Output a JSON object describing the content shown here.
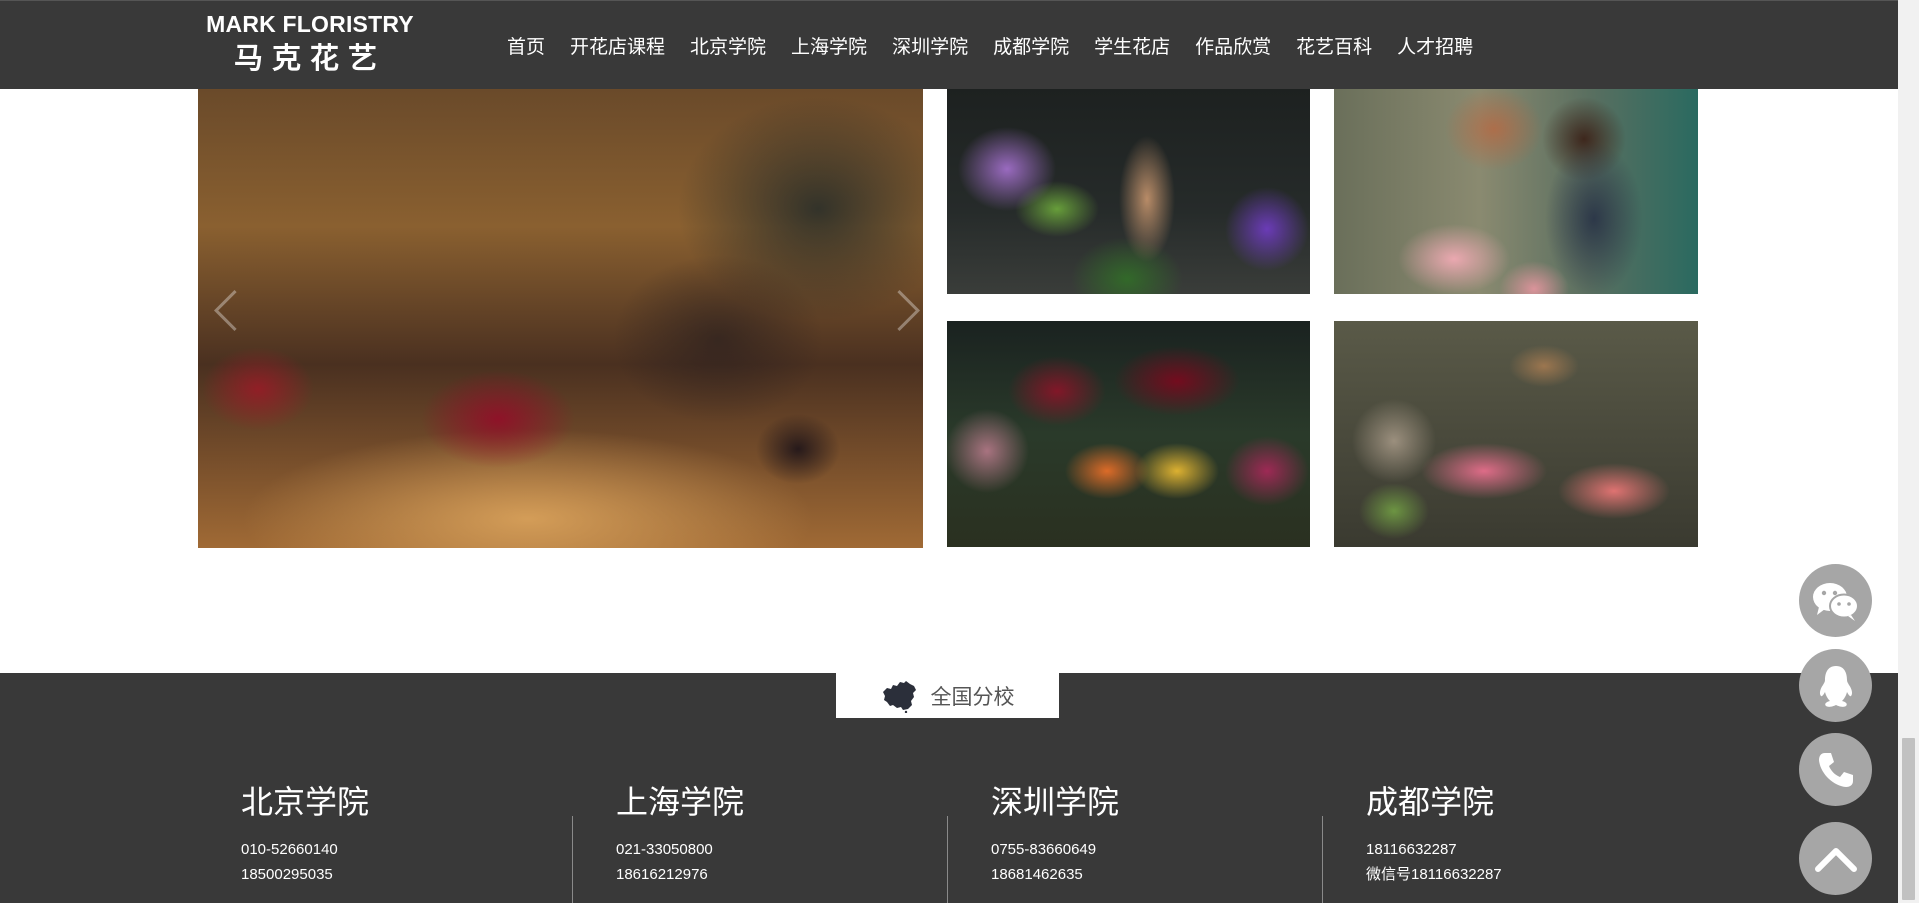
{
  "header": {
    "logo": {
      "en": "MARK FLORISTRY",
      "cn": "马克花艺"
    },
    "nav": [
      "首页",
      "开花店课程",
      "北京学院",
      "上海学院",
      "深圳学院",
      "成都学院",
      "学生花店",
      "作品欣赏",
      "花艺百科",
      "人才招聘"
    ]
  },
  "footer": {
    "branch_title": "全国分校",
    "campuses": [
      {
        "name": "北京学院",
        "lines": [
          "010-52660140",
          "18500295035"
        ]
      },
      {
        "name": "上海学院",
        "lines": [
          "021-33050800",
          "18616212976"
        ]
      },
      {
        "name": "深圳学院",
        "lines": [
          "0755-83660649",
          "18681462635"
        ]
      },
      {
        "name": "成都学院",
        "lines": [
          "18116632287",
          "微信号18116632287"
        ]
      }
    ]
  },
  "floating_buttons": [
    "wechat-icon",
    "qq-icon",
    "phone-icon",
    "arrow-up-icon"
  ],
  "colors": {
    "header_bg": "#393939",
    "footer_bg": "#393939",
    "float_btn_bg": "#a6a6a6",
    "text_light": "#ffffff"
  }
}
